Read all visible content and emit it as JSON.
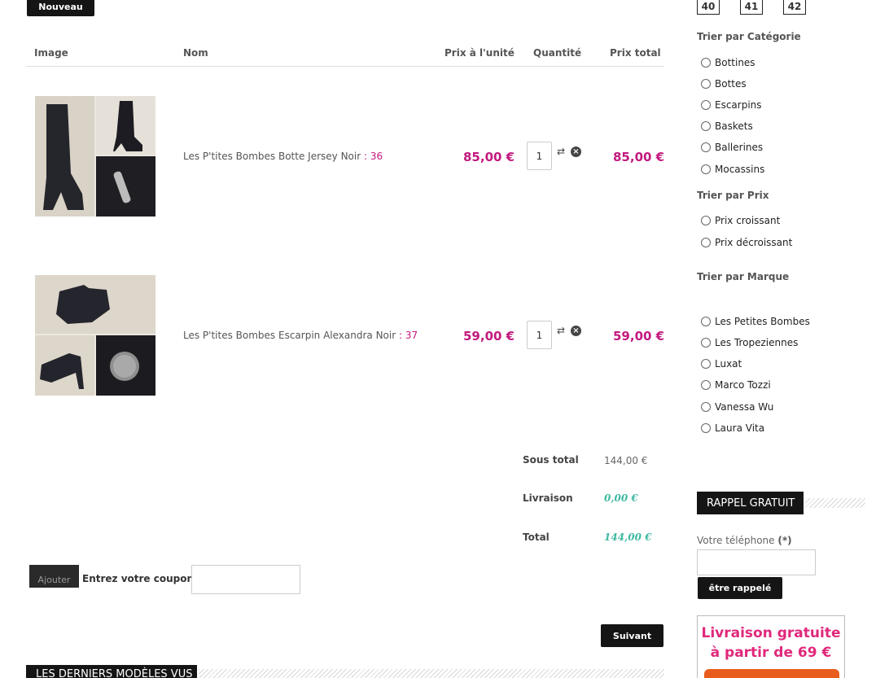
{
  "top": {
    "new_label": "Nouveau"
  },
  "cart": {
    "headers": {
      "image": "Image",
      "name": "Nom",
      "unit_price": "Prix à l'unité",
      "quantity": "Quantité",
      "total_price": "Prix total"
    },
    "items": [
      {
        "name": "Les P'tites Bombes Botte Jersey Noir",
        "size_sep": " : ",
        "size": "36",
        "unit_price": "85,00 €",
        "quantity": "1",
        "total": "85,00 €",
        "image_icon": "boot-photo"
      },
      {
        "name": "Les P'tites Bombes Escarpin Alexandra Noir",
        "size_sep": " : ",
        "size": "37",
        "unit_price": "59,00 €",
        "quantity": "1",
        "total": "59,00 €",
        "image_icon": "pump-photo"
      }
    ],
    "icons": {
      "update": "refresh-icon",
      "remove": "remove-icon"
    },
    "summary": {
      "subtotal_label": "Sous total",
      "subtotal_value": "144,00 €",
      "shipping_label": "Livraison",
      "shipping_value": "0,00 €",
      "total_label": "Total",
      "total_value": "144,00 €"
    },
    "coupon": {
      "button": "Ajouter",
      "label": "Entrez votre coupon",
      "value": ""
    },
    "next_label": "Suivant",
    "recent_title": "LES DERNIERS MODÈLES VUS"
  },
  "sidebar": {
    "sizes": [
      "40",
      "41",
      "42"
    ],
    "category": {
      "title": "Trier par Catégorie",
      "options": [
        "Bottines",
        "Bottes",
        "Escarpins",
        "Baskets",
        "Ballerines",
        "Mocassins"
      ]
    },
    "price": {
      "title": "Trier par Prix",
      "options": [
        "Prix croissant",
        "Prix décroissant"
      ]
    },
    "brand": {
      "title": "Trier par Marque",
      "options": [
        "Les Petites Bombes",
        "Les Tropeziennes",
        "Luxat",
        "Marco Tozzi",
        "Vanessa Wu",
        "Laura Vita"
      ]
    },
    "callback": {
      "title": "RAPPEL GRATUIT",
      "phone_label": "Votre téléphone",
      "required": "(*)",
      "phone_value": "",
      "button": "être rappelé"
    },
    "promo": {
      "line1": "Livraison gratuite",
      "line2": "à partir de 69 €"
    }
  },
  "colors": {
    "accent_pink": "#c21a7e",
    "teal": "#3fb9a2",
    "dark": "#151515",
    "promo_orange": "#e85d1b"
  }
}
